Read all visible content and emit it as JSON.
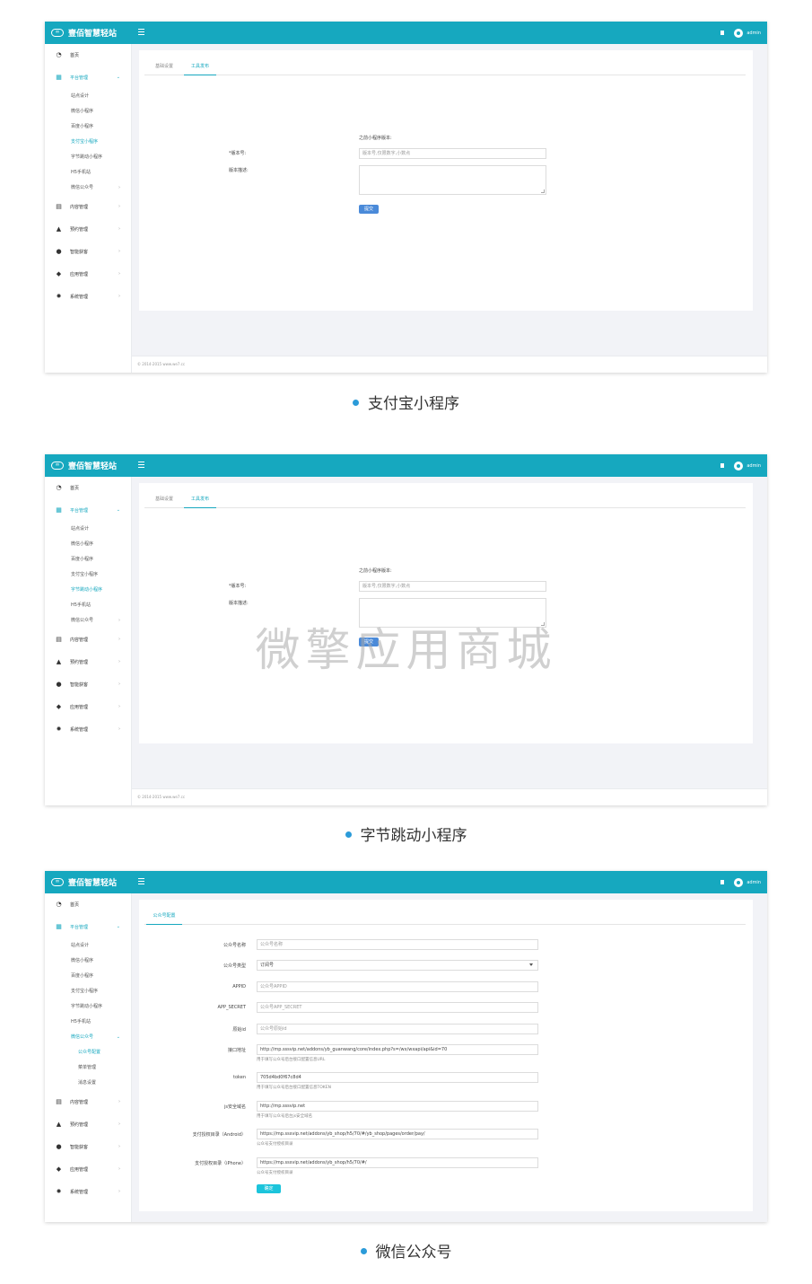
{
  "brand": "壹佰智慧轻站",
  "user": "admin",
  "footer": "© 2014-2015 www.we7.cc",
  "sidebar_top": [
    {
      "label": "首页",
      "icon": "dashboard-icon"
    },
    {
      "label": "平台管理",
      "icon": "grid-icon"
    }
  ],
  "sidebar_bottom": [
    {
      "label": "内容管理",
      "icon": "document-icon"
    },
    {
      "label": "预约管理",
      "icon": "bell-icon"
    },
    {
      "label": "智能获客",
      "icon": "users-icon"
    },
    {
      "label": "应用管理",
      "icon": "cube-icon"
    },
    {
      "label": "系统管理",
      "icon": "gear-icon"
    }
  ],
  "platform_sub": [
    "站点设计",
    "微信小程序",
    "百度小程序",
    "支付宝小程序",
    "字节跳动小程序",
    "H5手机站",
    "微信公众号"
  ],
  "wechat_sub": [
    "公众号配置",
    "菜单管理",
    "消息设置"
  ],
  "release_form": {
    "tabs": [
      "基础设置",
      "工具发布"
    ],
    "prev_version_label": "之前小程序版本:",
    "version_label": "*版本号:",
    "version_placeholder": "版本号,仅限数字,小数点",
    "desc_label": "版本描述:",
    "submit": "提交"
  },
  "wechat_form": {
    "tab": "公众号配置",
    "fields": [
      {
        "label": "公众号名称",
        "value": "公众号名称"
      },
      {
        "label": "公众号类型",
        "value": "订阅号"
      },
      {
        "label": "APPID",
        "value": "公众号APPID"
      },
      {
        "label": "APP_SECRET",
        "value": "公众号APP_SECRET"
      },
      {
        "label": "原始id",
        "value": "公众号原始id"
      },
      {
        "label": "接口地址",
        "value": "http://mp.sssvip.net/addons/yb_guanwang/core/index.php?s=/wx/wxapi/api&id=70",
        "help": "用于填写公众号后台接口配置信息URL"
      },
      {
        "label": "token",
        "value": "705d4bd0f67c8d4",
        "help": "用于填写公众号后台接口配置信息TOKEN"
      },
      {
        "label": "js安全域名",
        "value": "http://mp.sssvip.net",
        "help": "用于填写公众号后台js安全域名"
      },
      {
        "label": "支付授权目录（Android）",
        "value": "https://mp.sssvip.net/addons/yb_shop/h5/70/#/yb_shop/pages/order/pay/",
        "help": "公众号支付授权目录"
      },
      {
        "label": "支付授权目录（iPhone）",
        "value": "https://mp.sssvip.net/addons/yb_shop/h5/70/#/",
        "help": "公众号支付授权目录"
      }
    ],
    "submit": "确定"
  },
  "captions": [
    "支付宝小程序",
    "字节跳动小程序",
    "微信公众号"
  ],
  "watermark": "微擎应用商城"
}
